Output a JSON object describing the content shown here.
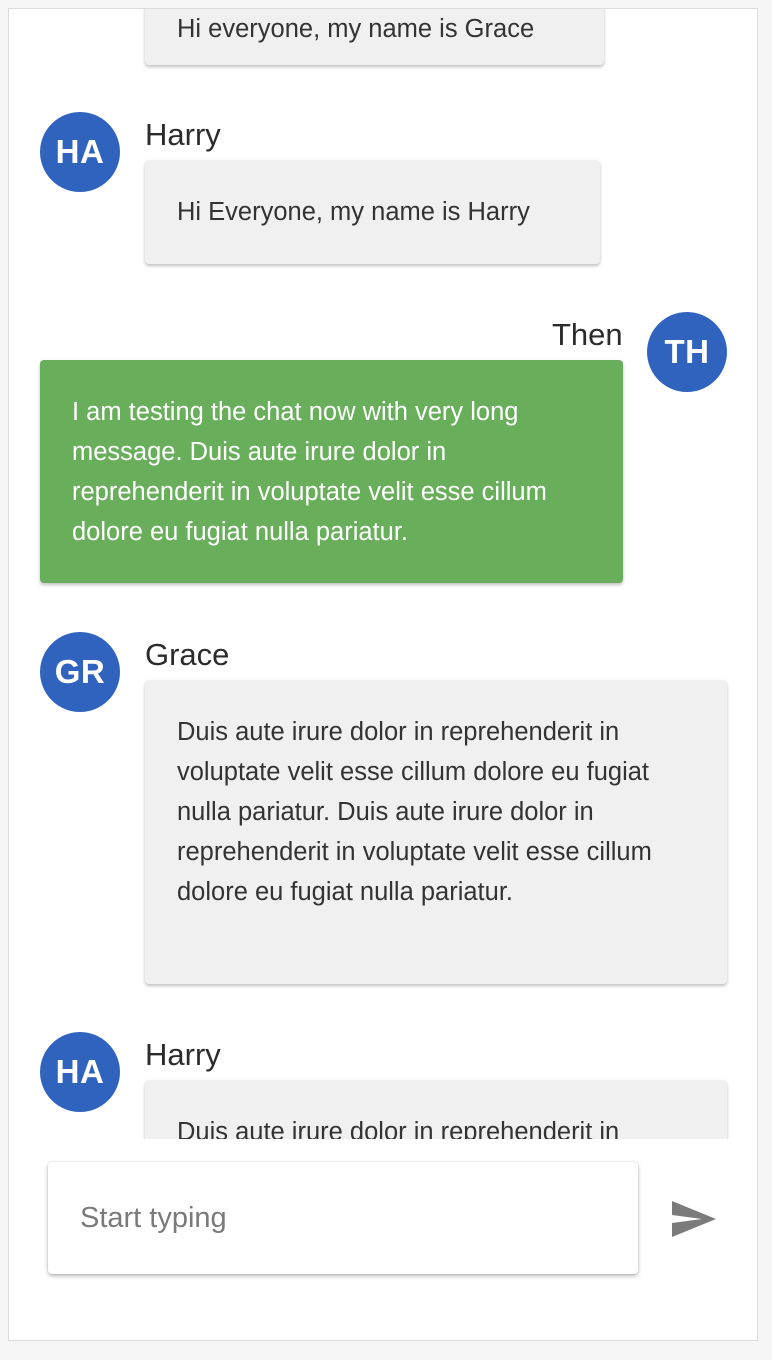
{
  "messages": [
    {
      "sender": "",
      "initials": "",
      "text": "Hi everyone, my name is Grace",
      "mine": false
    },
    {
      "sender": "Harry",
      "initials": "HA",
      "text": "Hi Everyone, my name is Harry",
      "mine": false
    },
    {
      "sender": "Then",
      "initials": "TH",
      "text": "I am testing the chat now with very long message. Duis aute irure dolor in reprehenderit in voluptate velit esse cillum dolore eu fugiat nulla pariatur.",
      "mine": true
    },
    {
      "sender": "Grace",
      "initials": "GR",
      "text": "Duis aute irure dolor in reprehenderit in voluptate velit esse cillum dolore eu fugiat nulla pariatur. Duis aute irure dolor in reprehenderit in voluptate velit esse cillum dolore eu fugiat nulla pariatur.",
      "mine": false
    },
    {
      "sender": "Harry",
      "initials": "HA",
      "text": "Duis aute irure dolor in reprehenderit in",
      "mine": false
    }
  ],
  "composer": {
    "placeholder": "Start typing",
    "value": ""
  },
  "colors": {
    "avatar": "#2f63bd",
    "mine_bubble": "#68ae5b",
    "other_bubble": "#f0f0f0"
  },
  "icons": {
    "send": "send-icon"
  }
}
